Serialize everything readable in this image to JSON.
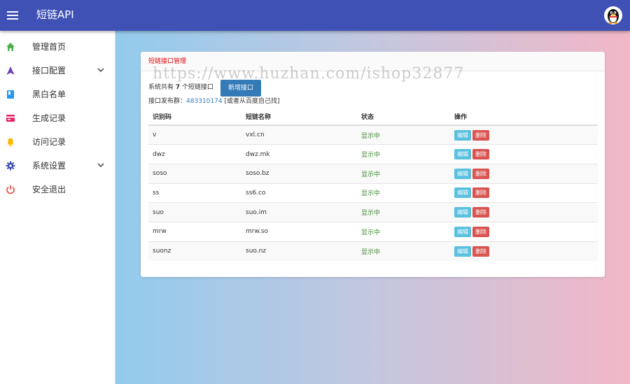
{
  "header": {
    "title": "短链API"
  },
  "sidebar": {
    "items": [
      {
        "label": "管理首页",
        "icon": "home-icon",
        "color": "#4caf50"
      },
      {
        "label": "接口配置",
        "icon": "triangle-icon",
        "color": "#6a3fb5",
        "has_submenu": true
      },
      {
        "label": "黑白名单",
        "icon": "book-icon",
        "color": "#2196f3"
      },
      {
        "label": "生成记录",
        "icon": "card-icon",
        "color": "#e91e63"
      },
      {
        "label": "访问记录",
        "icon": "bell-icon",
        "color": "#ffb300"
      },
      {
        "label": "系统设置",
        "icon": "gear-icon",
        "color": "#3f51b5",
        "has_submenu": true
      },
      {
        "label": "安全退出",
        "icon": "power-icon",
        "color": "#f44336"
      }
    ]
  },
  "panel": {
    "title": "短链接口管理",
    "summary_prefix": "系统共有",
    "count": "7",
    "summary_suffix": "个短链接口",
    "add_button": "新增接口",
    "group_prefix": "接口发布群：",
    "group_number": "483310174",
    "group_suffix": "[或者从百度自己找]"
  },
  "watermark": "https://www.huzhan.com/ishop32877",
  "table": {
    "headers": [
      "识别码",
      "短链名称",
      "状态",
      "操作"
    ],
    "rows": [
      {
        "code": "v",
        "name": "vxl.cn",
        "status": "显示中",
        "edit": "编辑",
        "delete": "删除"
      },
      {
        "code": "dwz",
        "name": "dwz.mk",
        "status": "显示中",
        "edit": "编辑",
        "delete": "删除"
      },
      {
        "code": "soso",
        "name": "soso.bz",
        "status": "显示中",
        "edit": "编辑",
        "delete": "删除"
      },
      {
        "code": "ss",
        "name": "ss6.co",
        "status": "显示中",
        "edit": "编辑",
        "delete": "删除"
      },
      {
        "code": "suo",
        "name": "suo.im",
        "status": "显示中",
        "edit": "编辑",
        "delete": "删除"
      },
      {
        "code": "mrw",
        "name": "mrw.so",
        "status": "显示中",
        "edit": "编辑",
        "delete": "删除"
      },
      {
        "code": "suonz",
        "name": "suo.nz",
        "status": "显示中",
        "edit": "编辑",
        "delete": "删除"
      }
    ]
  }
}
